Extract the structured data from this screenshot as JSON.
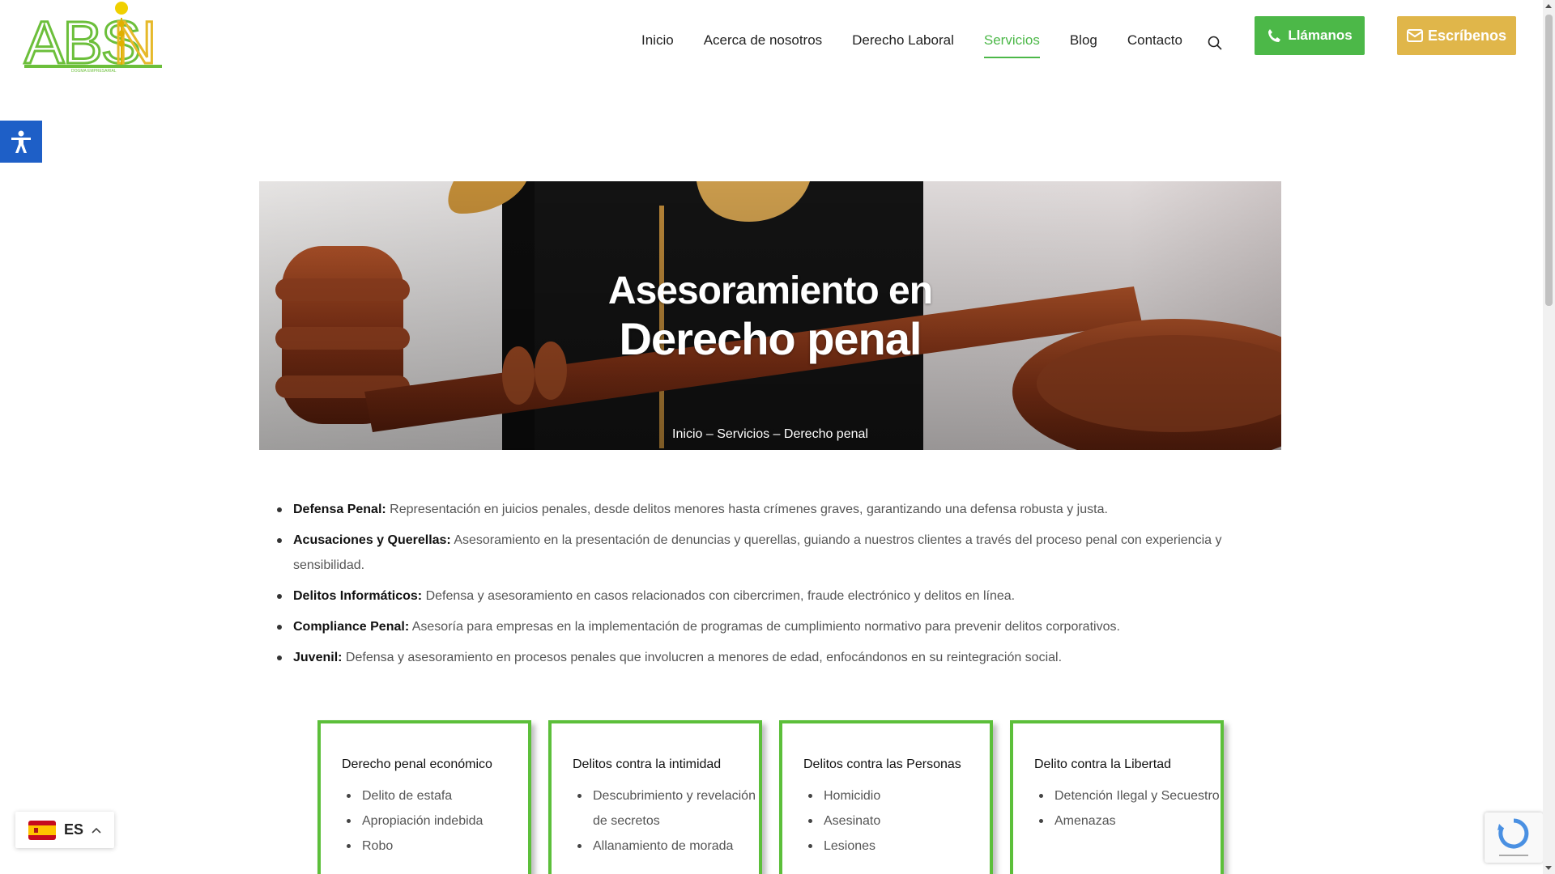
{
  "nav": {
    "items": [
      {
        "label": "Inicio",
        "active": false
      },
      {
        "label": "Acerca de nosotros",
        "active": false
      },
      {
        "label": "Derecho Laboral",
        "active": false
      },
      {
        "label": "Servicios",
        "active": true
      },
      {
        "label": "Blog",
        "active": false
      },
      {
        "label": "Contacto",
        "active": false
      }
    ],
    "search_icon": "search-icon"
  },
  "buttons": {
    "call_label": "Llámanos",
    "call_icon": "phone-icon",
    "mail_label": "Escríbenos",
    "mail_icon": "envelope-icon"
  },
  "hero": {
    "title_line1": "Asesoramiento en",
    "title_line2": "Derecho penal",
    "breadcrumb": "Inicio – Servicios – Derecho penal"
  },
  "services": [
    {
      "term": "Defensa Penal:",
      "desc": " Representación en juicios penales, desde delitos menores hasta crímenes graves, garantizando una defensa robusta y justa."
    },
    {
      "term": "Acusaciones y Querellas:",
      "desc": " Asesoramiento en la presentación de denuncias y querellas, guiando a nuestros clientes a través del proceso penal con experiencia y sensibilidad."
    },
    {
      "term": "Delitos Informáticos:",
      "desc": " Defensa y asesoramiento en casos relacionados con cibercrimen, fraude electrónico y delitos en línea."
    },
    {
      "term": "Compliance Penal:",
      "desc": " Asesoría para empresas en la implementación de programas de cumplimiento normativo para prevenir delitos corporativos."
    },
    {
      "term": "Juvenil:",
      "desc": " Defensa y asesoramiento en procesos penales que involucren a menores de edad, enfocándonos en su reintegración social."
    }
  ],
  "cards": [
    {
      "title": "Derecho penal económico",
      "items": [
        "Delito de estafa",
        "Apropiación indebida",
        "Robo"
      ]
    },
    {
      "title": "Delitos contra la intimidad",
      "items": [
        "Descubrimiento y revelación de secretos",
        "Allanamiento de morada"
      ]
    },
    {
      "title": "Delitos contra las Personas",
      "items": [
        "Homicidio",
        "Asesinato",
        "Lesiones"
      ]
    },
    {
      "title": "Delito contra la Libertad",
      "items": [
        "Detención Ilegal y Secuestro",
        "Amenazas"
      ]
    }
  ],
  "language": {
    "code": "ES",
    "flag": "spain-flag-icon"
  },
  "logo": {
    "text": "ABSIN",
    "tagline": "DOGMA EMPRESARIAL"
  },
  "colors": {
    "green": "#4cb848",
    "gold": "#e0b64a",
    "access_blue": "#1e5fc7"
  }
}
